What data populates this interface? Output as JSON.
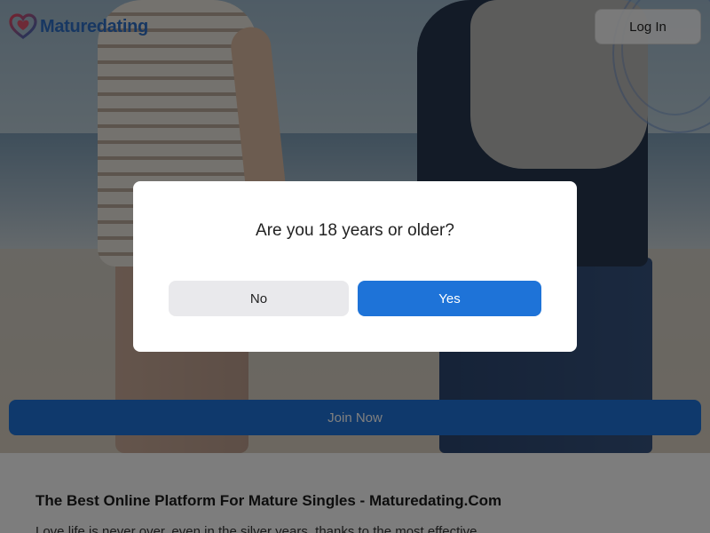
{
  "header": {
    "logo_text": "Maturedating",
    "login_label": "Log In"
  },
  "hero": {
    "join_label": "Join Now"
  },
  "content": {
    "title": "The Best Online Platform For Mature Singles - Maturedating.Com",
    "intro": "Love life is never over, even in the silver years, thanks to the most effective"
  },
  "age_modal": {
    "question": "Are you 18 years or older?",
    "no_label": "No",
    "yes_label": "Yes"
  },
  "colors": {
    "brand": "#2f6fc4",
    "primary_button": "#1e73d8",
    "secondary_button": "#e9e9ec",
    "overlay": "rgba(0,0,0,0.5)"
  }
}
